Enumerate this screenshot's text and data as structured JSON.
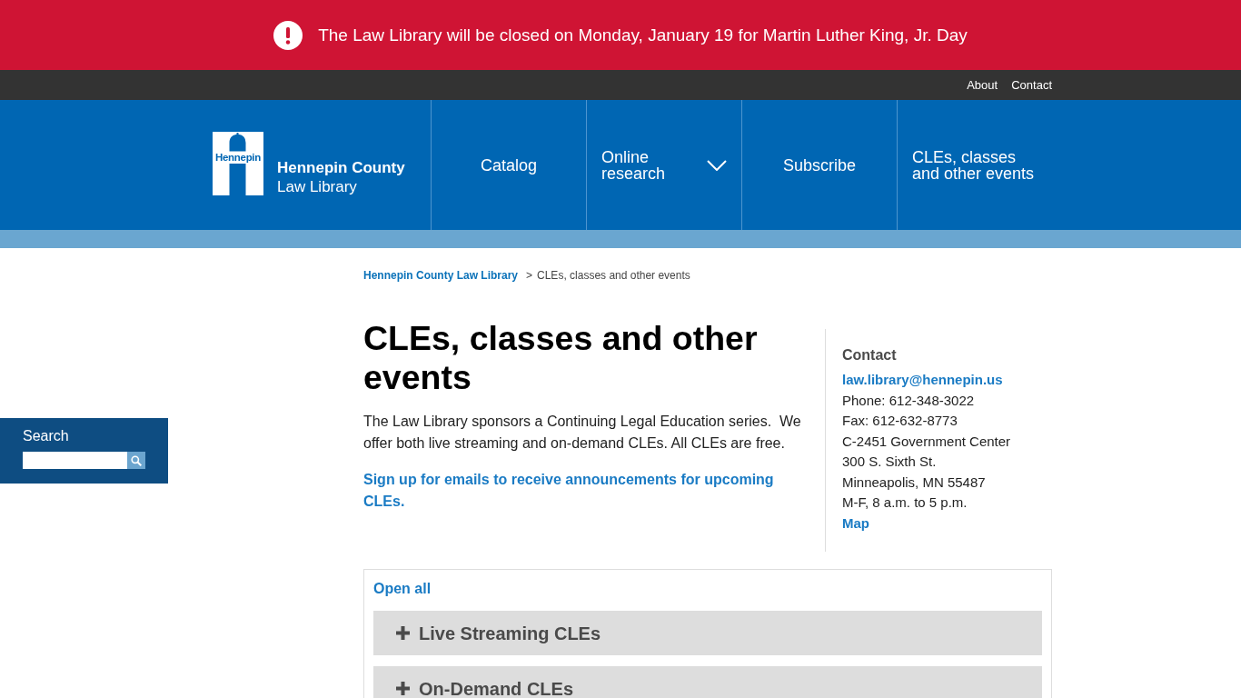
{
  "alert_banner": {
    "message": "The Law Library will be closed on Monday, January 19 for Martin Luther King, Jr. Day"
  },
  "utility_nav": [
    "About",
    "Contact"
  ],
  "header": {
    "logo": {
      "badge_text": "Hennepin",
      "title": "Hennepin County",
      "subtitle": "Law Library"
    },
    "nav": [
      {
        "label": "Catalog",
        "kind": "link"
      },
      {
        "label": "Online research",
        "kind": "dropdown"
      },
      {
        "label": "Subscribe",
        "kind": "link"
      },
      {
        "label": "CLEs, classes and other events",
        "kind": "link"
      }
    ]
  },
  "search_panel": {
    "label": "Search"
  },
  "breadcrumb": {
    "separator": ">",
    "items": [
      {
        "label": "Hennepin County Law Library",
        "kind": "link"
      },
      {
        "label": "CLEs, classes and other events",
        "kind": "current"
      }
    ]
  },
  "page": {
    "title": "CLEs, classes and other events",
    "intro": "The Law Library sponsors a Continuing Legal Education series.  We offer both live streaming and on-demand CLEs. All CLEs are free.",
    "signup_link": "Sign up for emails to receive announcements for upcoming CLEs."
  },
  "contact": {
    "heading": "Contact",
    "email": "law.library@hennepin.us",
    "lines": [
      "Phone: 612-348-3022",
      "Fax: 612-632-8773",
      "C-2451 Government Center",
      "300 S. Sixth St.",
      "Minneapolis, MN 55487",
      "M-F, 8 a.m. to 5 p.m."
    ],
    "map_link": "Map"
  },
  "accordion": {
    "open_all": "Open all",
    "sections": [
      {
        "title": "Live Streaming CLEs",
        "expanded": false
      },
      {
        "title": "On-Demand CLEs",
        "expanded": false
      }
    ]
  }
}
